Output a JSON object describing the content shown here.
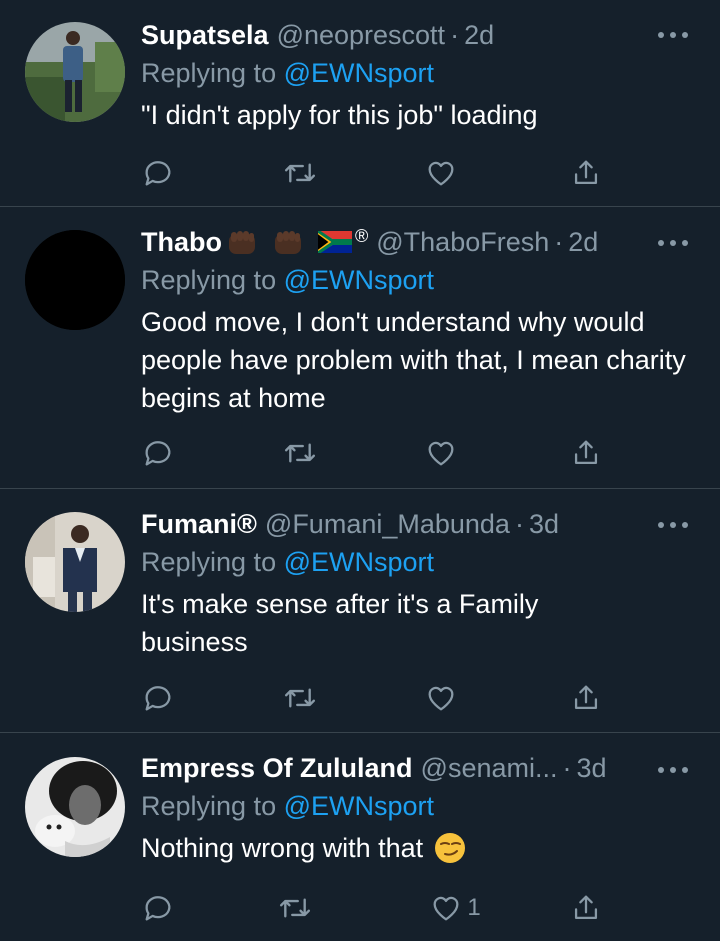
{
  "replying_label": "Replying to",
  "tweets": [
    {
      "name": "Supatsela",
      "handle": "@neoprescott",
      "time": "2d",
      "reply_to": "@EWNsport",
      "text": "\"I didn't apply for this job\" loading",
      "like_count": ""
    },
    {
      "name": "Thabo",
      "name_suffix": "®",
      "handle": "@ThaboFresh",
      "time": "2d",
      "reply_to": "@EWNsport",
      "text": "Good move, I don't understand why would people have problem with that, I mean charity begins at home",
      "like_count": ""
    },
    {
      "name": "Fumani®",
      "handle": "@Fumani_Mabunda",
      "time": "3d",
      "reply_to": "@EWNsport",
      "text": "It's make sense after it's a Family business",
      "like_count": ""
    },
    {
      "name": "Empress Of Zululand",
      "handle": "@senami...",
      "time": "3d",
      "reply_to": "@EWNsport",
      "text": "Nothing wrong with that",
      "like_count": "1"
    }
  ],
  "colors": {
    "background": "#15202b",
    "divider": "#38444d",
    "secondary_text": "#8899a6",
    "mention": "#1da1f2"
  },
  "icons": [
    "reply-icon",
    "retweet-icon",
    "like-icon",
    "share-icon",
    "more-icon",
    "smirk-emoji-icon",
    "raised-fist-icon",
    "south-africa-flag-icon"
  ]
}
